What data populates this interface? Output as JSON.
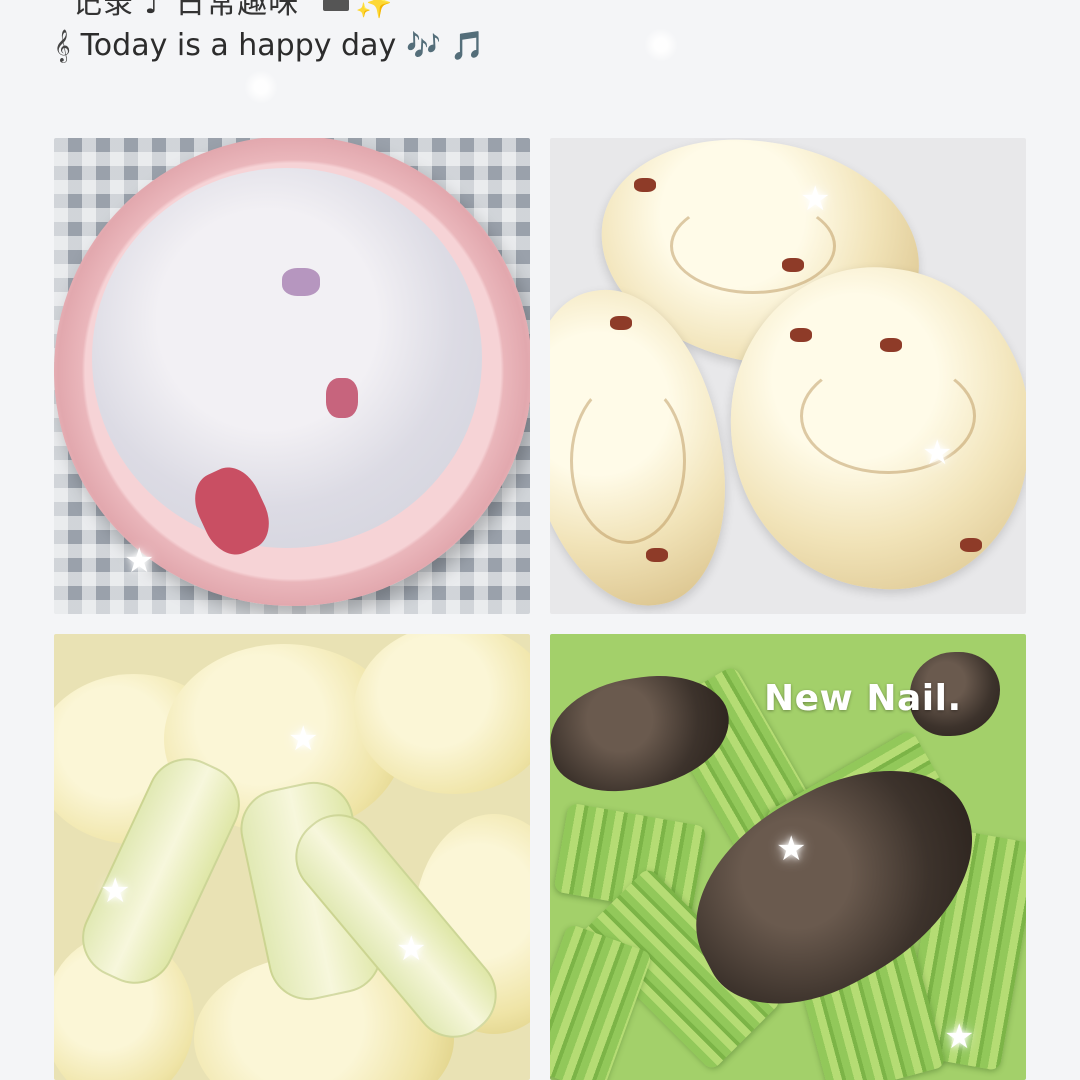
{
  "header": {
    "title_partial": "记录 ♪ 日常趣味",
    "title_sparkle": "✨",
    "subtitle_text": "Today is a happy day",
    "subtitle_notes": "🎶 🎵",
    "clef_icon": "𝄞"
  },
  "photos": [
    {
      "name": "congee",
      "overlay_text": ""
    },
    {
      "name": "buns",
      "overlay_text": ""
    },
    {
      "name": "cauliflower",
      "overlay_text": ""
    },
    {
      "name": "celery-mushroom",
      "overlay_text": "New Nail."
    }
  ],
  "sticker": {
    "star_icon": "★"
  }
}
